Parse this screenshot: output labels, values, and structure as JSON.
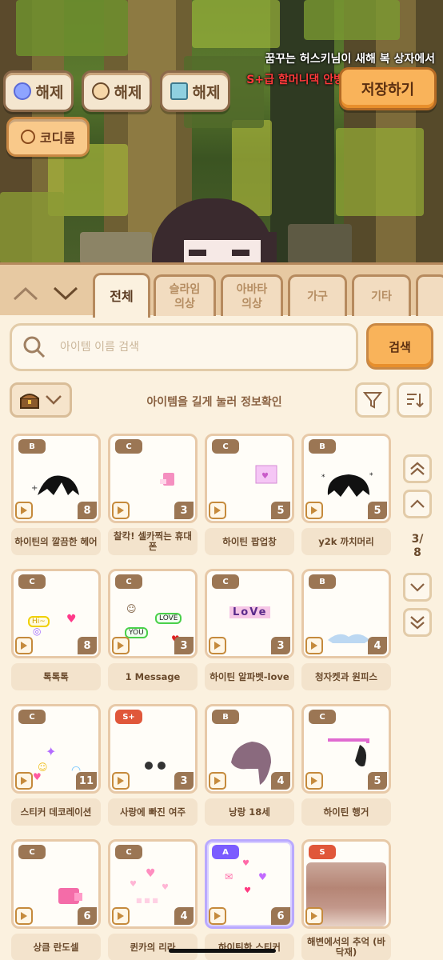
{
  "scene": {
    "notice_line1": "꿈꾸는 허스키님이 새해 복 상자에서",
    "notice_line2": "S+급 할머니댁 안방"
  },
  "top_buttons": {
    "slime_unequip": "해제",
    "avatar_unequip": "해제",
    "furniture_unequip": "해제",
    "coordi": "코디룸",
    "save": "저장하기"
  },
  "tabs": [
    {
      "label": "전체",
      "active": true
    },
    {
      "label": "슬라임\n의상",
      "active": false
    },
    {
      "label": "아바타\n의상",
      "active": false
    },
    {
      "label": "가구",
      "active": false
    },
    {
      "label": "기타",
      "active": false
    }
  ],
  "search": {
    "placeholder": "아이템 이름 검색",
    "button": "검색"
  },
  "hint": "아이템을 길게 눌러 정보확인",
  "pagination": {
    "current": "3/",
    "total": "8"
  },
  "items": [
    {
      "grade": "B",
      "count": "8",
      "name": "하이틴의 깔끔한 헤어"
    },
    {
      "grade": "C",
      "count": "3",
      "name": "찰칵! 셀카찍는 휴대폰"
    },
    {
      "grade": "C",
      "count": "5",
      "name": "하이틴 팝업창"
    },
    {
      "grade": "B",
      "count": "5",
      "name": "y2k 까치머리"
    },
    {
      "grade": "C",
      "count": "8",
      "name": "톡톡톡"
    },
    {
      "grade": "C",
      "count": "3",
      "name": "1 Message"
    },
    {
      "grade": "C",
      "count": "3",
      "name": "하이틴 알파벳-love"
    },
    {
      "grade": "B",
      "count": "4",
      "name": "청자켓과 원피스"
    },
    {
      "grade": "C",
      "count": "11",
      "name": "스티커 데코레이션"
    },
    {
      "grade": "S+",
      "count": "3",
      "name": "사랑에 빠진 여주"
    },
    {
      "grade": "B",
      "count": "4",
      "name": "낭랑 18세"
    },
    {
      "grade": "C",
      "count": "5",
      "name": "하이틴 행거"
    },
    {
      "grade": "C",
      "count": "6",
      "name": "상큼 란도셀"
    },
    {
      "grade": "C",
      "count": "4",
      "name": "퀸카의 리라"
    },
    {
      "grade": "A",
      "count": "6",
      "name": "하이틴한 스티커"
    },
    {
      "grade": "S",
      "count": "",
      "name": "해변에서의 추억 (바닥재)"
    }
  ],
  "art_text": {
    "hi": "Hi~",
    "love": "LOVE",
    "you": "YOU",
    "love_letters": "LoVe"
  },
  "colors": {
    "accent": "#f9b35a",
    "panel_bg": "#fbf1df",
    "grade_default": "#9b7654",
    "grade_s": "#e0573a",
    "grade_a": "#7b5cff",
    "notice_red": "#ff3b3b"
  }
}
